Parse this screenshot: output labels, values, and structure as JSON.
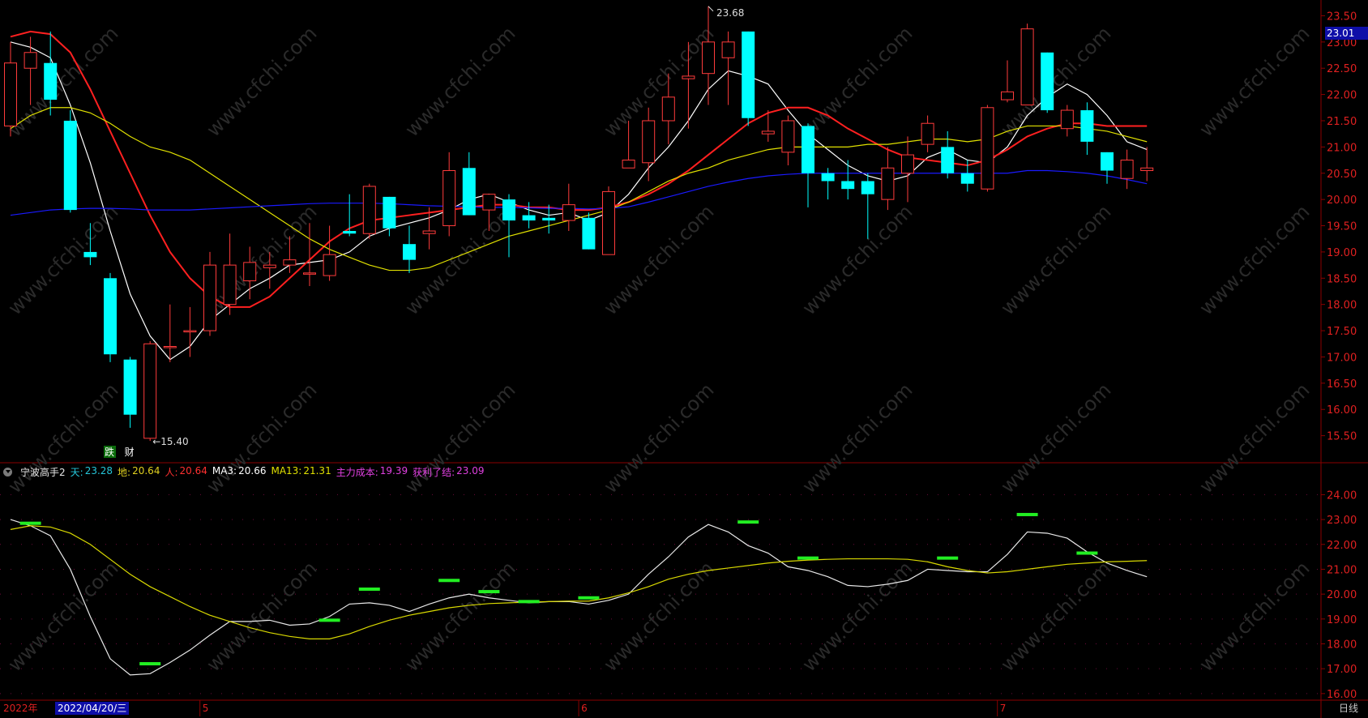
{
  "chart_data": [
    {
      "type": "candlestick",
      "panel": "main",
      "ylim": [
        15.0,
        23.8
      ],
      "y_ticks": [
        "23.50",
        "23.00",
        "22.50",
        "22.00",
        "21.50",
        "21.00",
        "20.50",
        "20.00",
        "19.50",
        "19.00",
        "18.50",
        "18.00",
        "17.50",
        "17.00",
        "16.50",
        "16.00",
        "15.50"
      ],
      "candles": [
        {
          "o": 21.4,
          "h": 23.0,
          "l": 21.2,
          "c": 22.6
        },
        {
          "o": 22.5,
          "h": 23.1,
          "l": 21.8,
          "c": 22.8
        },
        {
          "o": 22.6,
          "h": 23.2,
          "l": 21.6,
          "c": 21.9
        },
        {
          "o": 21.5,
          "h": 21.7,
          "l": 19.75,
          "c": 19.8
        },
        {
          "o": 19.0,
          "h": 19.55,
          "l": 18.75,
          "c": 18.9
        },
        {
          "o": 18.5,
          "h": 18.6,
          "l": 16.9,
          "c": 17.05
        },
        {
          "o": 16.95,
          "h": 17.0,
          "l": 15.65,
          "c": 15.9
        },
        {
          "o": 15.45,
          "h": 17.3,
          "l": 15.4,
          "c": 17.25
        },
        {
          "o": 17.2,
          "h": 18.0,
          "l": 16.9,
          "c": 17.2
        },
        {
          "o": 17.5,
          "h": 17.95,
          "l": 17.0,
          "c": 17.5
        },
        {
          "o": 17.5,
          "h": 19.0,
          "l": 17.4,
          "c": 18.75
        },
        {
          "o": 18.0,
          "h": 19.35,
          "l": 17.8,
          "c": 18.75
        },
        {
          "o": 18.45,
          "h": 19.1,
          "l": 18.1,
          "c": 18.8
        },
        {
          "o": 18.7,
          "h": 19.0,
          "l": 18.3,
          "c": 18.75
        },
        {
          "o": 18.75,
          "h": 19.3,
          "l": 18.6,
          "c": 18.85
        },
        {
          "o": 18.6,
          "h": 19.55,
          "l": 18.35,
          "c": 18.6
        },
        {
          "o": 18.55,
          "h": 19.5,
          "l": 18.45,
          "c": 18.95
        },
        {
          "o": 19.4,
          "h": 20.1,
          "l": 19.3,
          "c": 19.35
        },
        {
          "o": 19.35,
          "h": 20.3,
          "l": 19.25,
          "c": 20.25
        },
        {
          "o": 20.05,
          "h": 20.05,
          "l": 19.3,
          "c": 19.45
        },
        {
          "o": 19.15,
          "h": 19.5,
          "l": 18.6,
          "c": 18.85
        },
        {
          "o": 19.35,
          "h": 19.85,
          "l": 19.05,
          "c": 19.4
        },
        {
          "o": 19.5,
          "h": 20.9,
          "l": 19.3,
          "c": 20.55
        },
        {
          "o": 20.6,
          "h": 20.9,
          "l": 19.7,
          "c": 19.7
        },
        {
          "o": 19.8,
          "h": 20.1,
          "l": 19.4,
          "c": 20.1
        },
        {
          "o": 20.0,
          "h": 20.1,
          "l": 18.9,
          "c": 19.6
        },
        {
          "o": 19.7,
          "h": 19.95,
          "l": 19.45,
          "c": 19.6
        },
        {
          "o": 19.65,
          "h": 19.9,
          "l": 19.35,
          "c": 19.6
        },
        {
          "o": 19.6,
          "h": 20.3,
          "l": 19.4,
          "c": 19.9
        },
        {
          "o": 19.65,
          "h": 19.75,
          "l": 19.05,
          "c": 19.05
        },
        {
          "o": 18.95,
          "h": 20.25,
          "l": 18.95,
          "c": 20.15
        },
        {
          "o": 20.6,
          "h": 21.5,
          "l": 20.6,
          "c": 20.75
        },
        {
          "o": 20.7,
          "h": 21.75,
          "l": 20.35,
          "c": 21.5
        },
        {
          "o": 21.5,
          "h": 22.4,
          "l": 21.05,
          "c": 21.95
        },
        {
          "o": 22.3,
          "h": 23.0,
          "l": 21.35,
          "c": 22.35
        },
        {
          "o": 22.4,
          "h": 23.68,
          "l": 21.8,
          "c": 23.0
        },
        {
          "o": 22.7,
          "h": 23.2,
          "l": 21.8,
          "c": 23.0
        },
        {
          "o": 23.2,
          "h": 23.2,
          "l": 21.4,
          "c": 21.55
        },
        {
          "o": 21.25,
          "h": 21.7,
          "l": 21.1,
          "c": 21.3
        },
        {
          "o": 20.9,
          "h": 21.6,
          "l": 20.65,
          "c": 21.5
        },
        {
          "o": 21.4,
          "h": 21.45,
          "l": 19.85,
          "c": 20.5
        },
        {
          "o": 20.5,
          "h": 20.6,
          "l": 20.0,
          "c": 20.35
        },
        {
          "o": 20.35,
          "h": 20.75,
          "l": 20.0,
          "c": 20.2
        },
        {
          "o": 20.35,
          "h": 20.5,
          "l": 19.25,
          "c": 20.1
        },
        {
          "o": 20.0,
          "h": 21.0,
          "l": 19.8,
          "c": 20.6
        },
        {
          "o": 20.5,
          "h": 21.2,
          "l": 19.95,
          "c": 20.85
        },
        {
          "o": 21.05,
          "h": 21.6,
          "l": 20.9,
          "c": 21.45
        },
        {
          "o": 21.0,
          "h": 21.3,
          "l": 20.4,
          "c": 20.5
        },
        {
          "o": 20.5,
          "h": 20.75,
          "l": 20.15,
          "c": 20.3
        },
        {
          "o": 20.2,
          "h": 21.8,
          "l": 20.15,
          "c": 21.75
        },
        {
          "o": 21.9,
          "h": 22.65,
          "l": 21.85,
          "c": 22.05
        },
        {
          "o": 21.8,
          "h": 23.35,
          "l": 21.8,
          "c": 23.25
        },
        {
          "o": 22.8,
          "h": 22.8,
          "l": 21.65,
          "c": 21.7
        },
        {
          "o": 21.35,
          "h": 21.8,
          "l": 21.2,
          "c": 21.7
        },
        {
          "o": 21.7,
          "h": 21.85,
          "l": 20.85,
          "c": 21.1
        },
        {
          "o": 20.9,
          "h": 20.9,
          "l": 20.3,
          "c": 20.55
        },
        {
          "o": 20.4,
          "h": 20.95,
          "l": 20.2,
          "c": 20.75
        },
        {
          "o": 20.55,
          "h": 21.0,
          "l": 20.35,
          "c": 20.6
        }
      ],
      "ma_series": [
        {
          "color": "#ffffff",
          "values": [
            23.0,
            22.9,
            22.7,
            21.8,
            20.7,
            19.4,
            18.2,
            17.4,
            16.95,
            17.2,
            17.7,
            18.0,
            18.3,
            18.5,
            18.75,
            18.8,
            18.85,
            19.0,
            19.3,
            19.45,
            19.55,
            19.65,
            19.8,
            20.0,
            20.1,
            19.95,
            19.8,
            19.7,
            19.75,
            19.6,
            19.75,
            20.1,
            20.6,
            21.0,
            21.5,
            22.1,
            22.45,
            22.35,
            22.2,
            21.7,
            21.25,
            20.95,
            20.65,
            20.45,
            20.35,
            20.45,
            20.8,
            20.95,
            20.75,
            20.7,
            21.0,
            21.6,
            21.95,
            22.2,
            22.0,
            21.6,
            21.1,
            20.95
          ]
        },
        {
          "color": "#ff2020",
          "values": [
            23.1,
            23.2,
            23.15,
            22.8,
            22.1,
            21.3,
            20.5,
            19.7,
            19.0,
            18.5,
            18.15,
            17.95,
            17.95,
            18.15,
            18.5,
            18.85,
            19.2,
            19.45,
            19.6,
            19.65,
            19.7,
            19.75,
            19.8,
            19.85,
            19.9,
            19.9,
            19.85,
            19.85,
            19.8,
            19.8,
            19.85,
            19.95,
            20.1,
            20.3,
            20.55,
            20.85,
            21.15,
            21.45,
            21.65,
            21.75,
            21.75,
            21.6,
            21.35,
            21.15,
            20.95,
            20.8,
            20.75,
            20.7,
            20.65,
            20.75,
            20.95,
            21.2,
            21.35,
            21.45,
            21.45,
            21.4,
            21.4,
            21.4
          ]
        },
        {
          "color": "#e0e000",
          "values": [
            21.35,
            21.6,
            21.75,
            21.75,
            21.65,
            21.45,
            21.2,
            21.0,
            20.9,
            20.75,
            20.5,
            20.25,
            20.0,
            19.75,
            19.5,
            19.25,
            19.05,
            18.9,
            18.75,
            18.65,
            18.65,
            18.7,
            18.85,
            19.0,
            19.15,
            19.3,
            19.4,
            19.5,
            19.6,
            19.7,
            19.8,
            19.95,
            20.15,
            20.35,
            20.5,
            20.6,
            20.75,
            20.85,
            20.95,
            21.0,
            21.0,
            21.0,
            21.0,
            21.05,
            21.05,
            21.1,
            21.15,
            21.15,
            21.1,
            21.15,
            21.3,
            21.4,
            21.4,
            21.4,
            21.35,
            21.3,
            21.2,
            21.1
          ]
        },
        {
          "color": "#1a1aff",
          "values": [
            19.7,
            19.75,
            19.8,
            19.82,
            19.83,
            19.83,
            19.82,
            19.8,
            19.8,
            19.8,
            19.82,
            19.84,
            19.86,
            19.88,
            19.9,
            19.92,
            19.93,
            19.93,
            19.93,
            19.92,
            19.9,
            19.88,
            19.87,
            19.86,
            19.85,
            19.85,
            19.84,
            19.83,
            19.83,
            19.82,
            19.83,
            19.86,
            19.95,
            20.05,
            20.15,
            20.25,
            20.33,
            20.4,
            20.45,
            20.48,
            20.5,
            20.5,
            20.5,
            20.5,
            20.5,
            20.5,
            20.5,
            20.5,
            20.5,
            20.5,
            20.5,
            20.55,
            20.55,
            20.53,
            20.5,
            20.45,
            20.38,
            20.3
          ]
        }
      ],
      "annotations": [
        {
          "text": "23.68",
          "candle_index": 35,
          "at": "high"
        },
        {
          "text": "←15.40",
          "candle_index": 7,
          "at": "low"
        },
        {
          "text": "跌",
          "candle_index": 5,
          "color": "#ffffff",
          "bg": "#0a6b0a"
        },
        {
          "text": "财",
          "candle_index": 6,
          "color": "#ffffff"
        }
      ],
      "last_price": "23.01"
    },
    {
      "type": "line",
      "panel": "indicator",
      "ylim": [
        15.8,
        24.6
      ],
      "y_ticks": [
        "24.00",
        "23.00",
        "22.00",
        "21.00",
        "20.00",
        "19.00",
        "18.00",
        "17.00",
        "16.00"
      ],
      "series": [
        {
          "color": "#e8e8e8",
          "values": [
            23.0,
            22.75,
            22.35,
            21.0,
            19.1,
            17.4,
            16.75,
            16.8,
            17.25,
            17.75,
            18.35,
            18.9,
            18.9,
            18.95,
            18.75,
            18.8,
            19.1,
            19.6,
            19.65,
            19.55,
            19.3,
            19.6,
            19.85,
            20.0,
            19.85,
            19.75,
            19.65,
            19.7,
            19.7,
            19.6,
            19.75,
            20.0,
            20.8,
            21.5,
            22.3,
            22.8,
            22.5,
            21.95,
            21.65,
            21.1,
            20.95,
            20.7,
            20.35,
            20.3,
            20.4,
            20.55,
            21.0,
            20.95,
            20.9,
            20.9,
            21.6,
            22.5,
            22.45,
            22.25,
            21.7,
            21.25,
            20.95,
            20.7
          ]
        },
        {
          "color": "#d8d800",
          "values": [
            22.6,
            22.75,
            22.7,
            22.45,
            22.0,
            21.4,
            20.8,
            20.3,
            19.9,
            19.5,
            19.15,
            18.9,
            18.65,
            18.45,
            18.3,
            18.2,
            18.2,
            18.4,
            18.7,
            18.95,
            19.15,
            19.3,
            19.45,
            19.55,
            19.62,
            19.65,
            19.68,
            19.7,
            19.72,
            19.72,
            19.85,
            20.05,
            20.3,
            20.6,
            20.8,
            20.95,
            21.05,
            21.15,
            21.25,
            21.32,
            21.37,
            21.4,
            21.42,
            21.42,
            21.42,
            21.4,
            21.3,
            21.1,
            20.95,
            20.85,
            20.9,
            21.0,
            21.1,
            21.2,
            21.25,
            21.3,
            21.32,
            21.35
          ]
        }
      ],
      "bars": [
        {
          "candle_index": 1,
          "value": 22.85
        },
        {
          "candle_index": 7,
          "value": 17.2
        },
        {
          "candle_index": 16,
          "value": 18.95
        },
        {
          "candle_index": 18,
          "value": 20.2
        },
        {
          "candle_index": 22,
          "value": 20.55
        },
        {
          "candle_index": 24,
          "value": 20.1
        },
        {
          "candle_index": 26,
          "value": 19.7
        },
        {
          "candle_index": 29,
          "value": 19.85
        },
        {
          "candle_index": 37,
          "value": 22.9
        },
        {
          "candle_index": 40,
          "value": 21.45
        },
        {
          "candle_index": 47,
          "value": 21.45
        },
        {
          "candle_index": 51,
          "value": 23.2
        },
        {
          "candle_index": 54,
          "value": 21.65
        }
      ]
    }
  ],
  "indicator_legend": {
    "name": "宁波高手2",
    "items": [
      {
        "label": "天:",
        "value": "23.28",
        "color": "#26c6da"
      },
      {
        "label": "地:",
        "value": "20.64",
        "color": "#e0d020"
      },
      {
        "label": "人:",
        "value": "20.64",
        "color": "#ff3030"
      },
      {
        "label": "MA3:",
        "value": "20.66",
        "color": "#ffffff"
      },
      {
        "label": "MA13:",
        "value": "21.31",
        "color": "#e0e000"
      },
      {
        "label": "主力成本:",
        "value": "19.39",
        "color": "#e040e0"
      },
      {
        "label": "获利了结:",
        "value": "23.09",
        "color": "#e040e0"
      }
    ]
  },
  "x_axis": {
    "year": "2022年",
    "date_badge": "2022/04/20/三",
    "months": [
      {
        "label": "5",
        "candle_index": 10
      },
      {
        "label": "6",
        "candle_index": 29
      },
      {
        "label": "7",
        "candle_index": 50
      }
    ],
    "period": "日线"
  },
  "watermark": "www.cfchi.com",
  "colors": {
    "up": "#ff3b3b",
    "down": "#00ffff",
    "grid": "#8b0000",
    "axis_text": "#e02020",
    "background": "#000000"
  }
}
